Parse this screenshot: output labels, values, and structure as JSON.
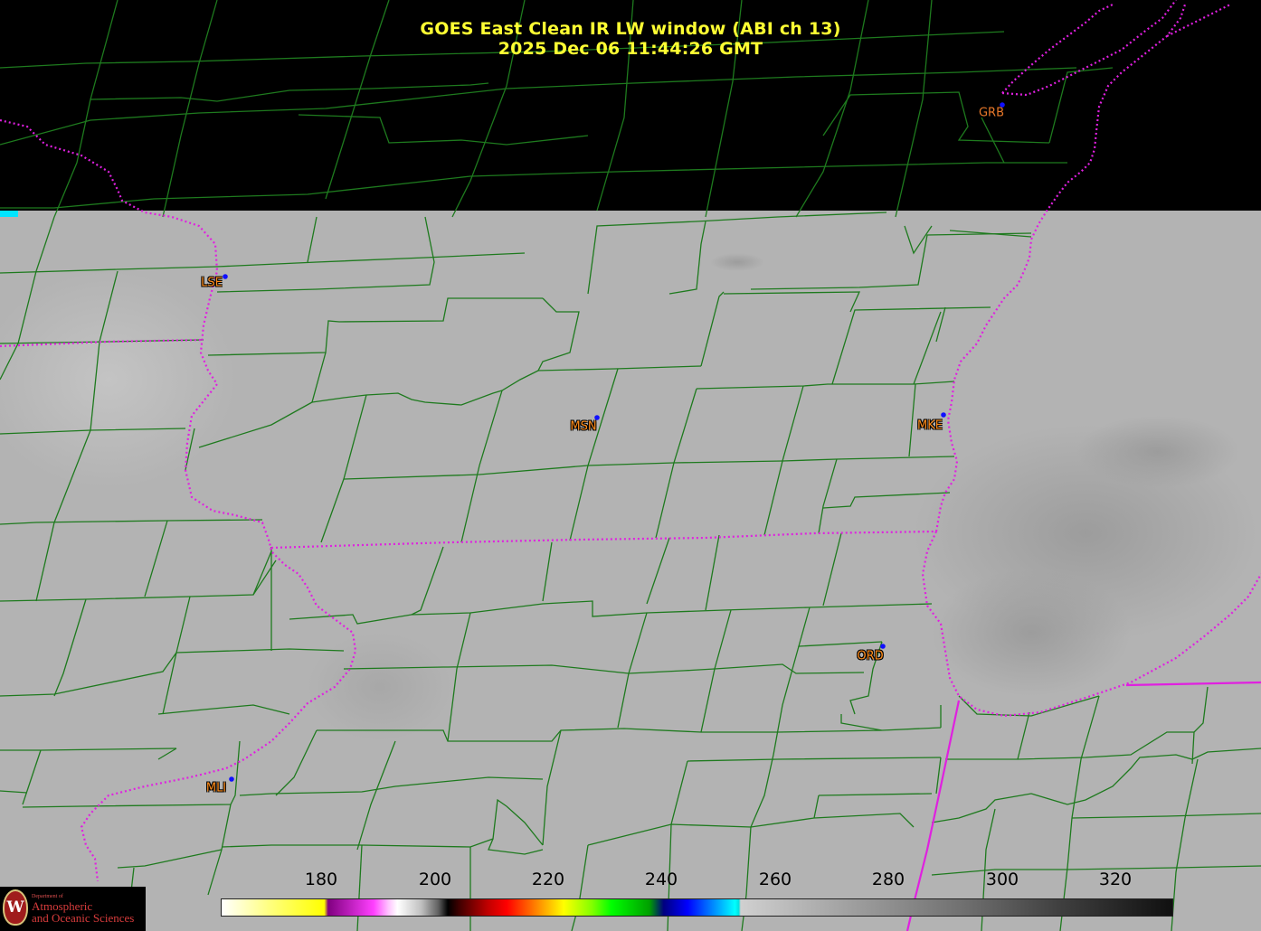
{
  "title": {
    "line1": "GOES East Clean IR LW window (ABI ch 13)",
    "line2": "2025 Dec 06  11:44:26 GMT"
  },
  "stations": [
    {
      "id": "GRB",
      "label": "GRB"
    },
    {
      "id": "LSE",
      "label": "LSE"
    },
    {
      "id": "MSN",
      "label": "MSN"
    },
    {
      "id": "MKE",
      "label": "MKE"
    },
    {
      "id": "ORD",
      "label": "ORD"
    },
    {
      "id": "MLI",
      "label": "MLI"
    }
  ],
  "colorbar": {
    "ticks": [
      "180",
      "200",
      "220",
      "240",
      "260",
      "280",
      "300",
      "320"
    ]
  },
  "logo": {
    "small": "Department of",
    "line1": "Atmospheric",
    "line2": "and Oceanic Sciences",
    "seal": "W"
  },
  "colors": {
    "background": "#000000",
    "imagery": "#b4b4b4",
    "county_lines": "#1e7a1e",
    "state_lines": "#e020e0",
    "title": "#ffff33",
    "station_label": "#ff8c1a",
    "station_dot": "#1010ff"
  }
}
